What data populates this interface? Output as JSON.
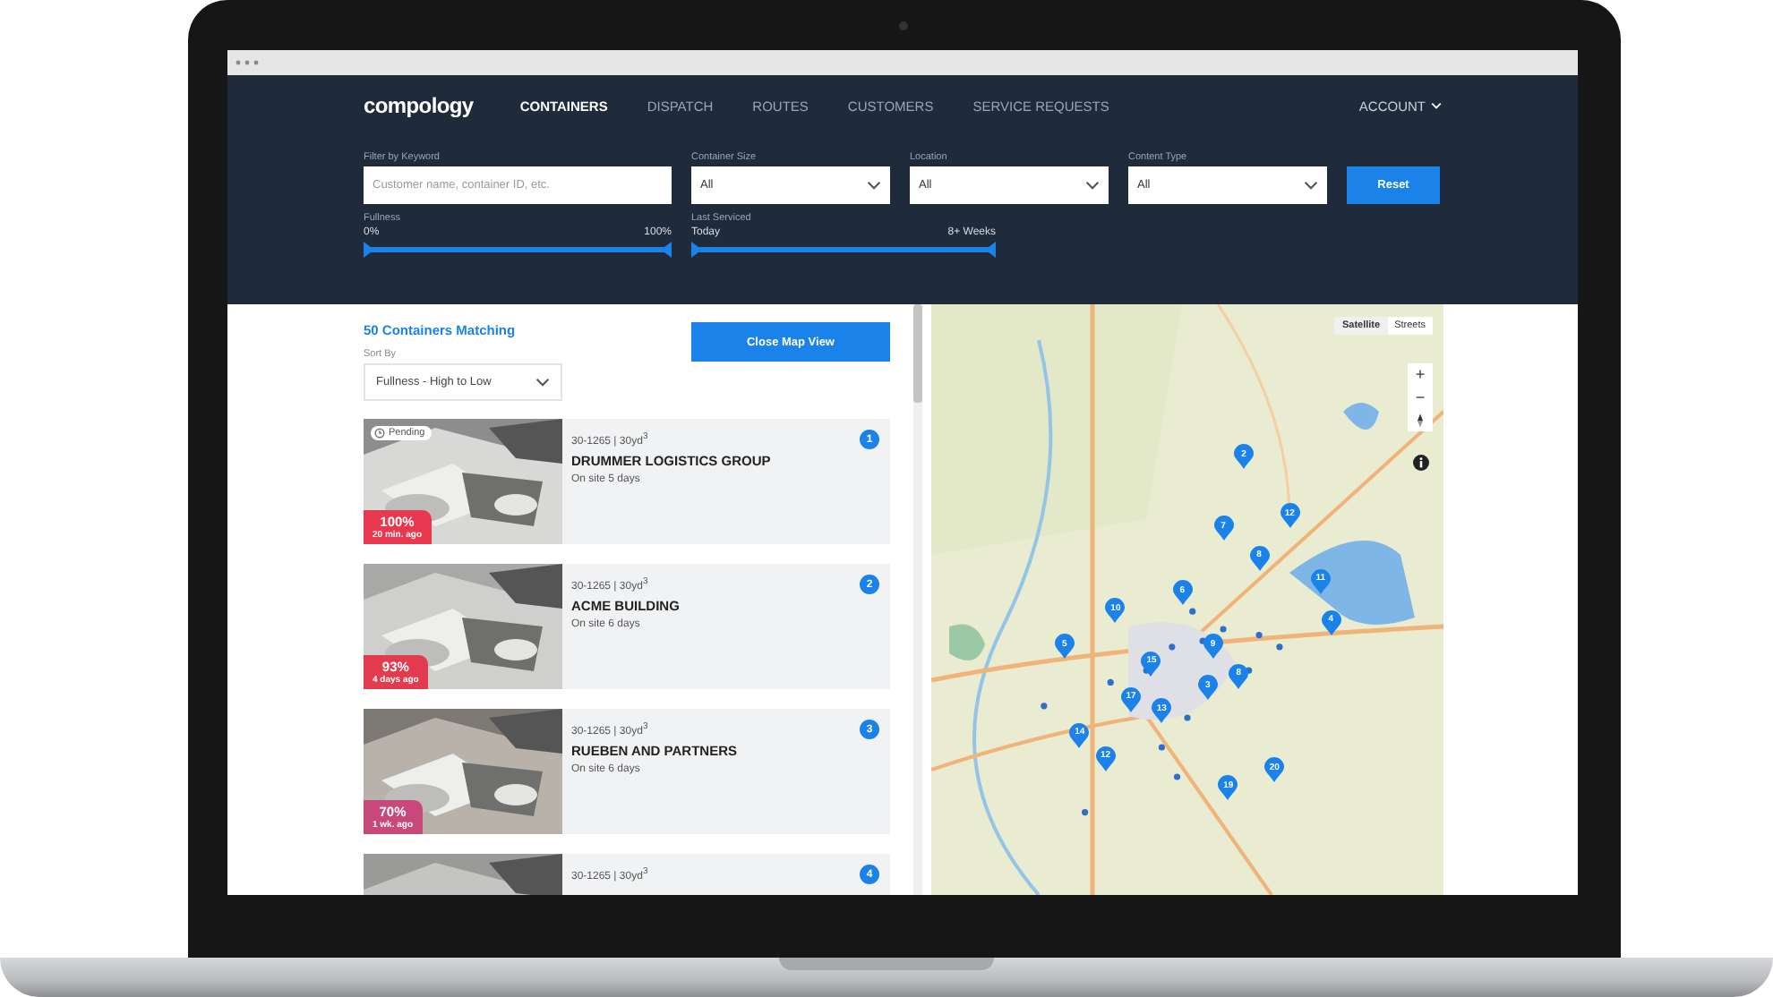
{
  "nav": {
    "logo": "compology",
    "items": [
      {
        "label": "CONTAINERS",
        "selected": true
      },
      {
        "label": "DISPATCH",
        "selected": false
      },
      {
        "label": "ROUTES",
        "selected": false
      },
      {
        "label": "CUSTOMERS",
        "selected": false
      },
      {
        "label": "SERVICE REQUESTS",
        "selected": false
      }
    ],
    "account": "ACCOUNT"
  },
  "filters": {
    "keyword": {
      "label": "Filter by Keyword",
      "placeholder": "Customer name, container ID, etc."
    },
    "selects": [
      {
        "label": "Container Size",
        "value": "All"
      },
      {
        "label": "Location",
        "value": "All"
      },
      {
        "label": "Content Type",
        "value": "All"
      }
    ],
    "reset": "Reset",
    "ranges": [
      {
        "label": "Fullness",
        "min": "0%",
        "max": "100%",
        "level": 1
      },
      {
        "label": "Last Serviced",
        "min": "Today",
        "max": "8+ Weeks",
        "level": 1
      }
    ]
  },
  "list": {
    "count": "50 Containers Matching",
    "sort_label": "Sort By",
    "sort_value": "Fullness - High to Low",
    "map_button": "Close Map View",
    "items": [
      {
        "pending": true,
        "pending_label": "Pending",
        "fullness": "100%",
        "age": "20 min. ago",
        "color": "#e8384f",
        "meta": "30-1265 | 30yd$^{3}$",
        "name": "DRUMMER LOGISTICS GROUP",
        "onsite": "On site 5 days",
        "number": "1"
      },
      {
        "pending": false,
        "fullness": "93%",
        "age": "4 days ago",
        "color": "#e23b4e",
        "meta": "30-1265 | 30yd$^{3}$",
        "name": "ACME BUILDING",
        "onsite": "On site 6 days",
        "number": "2"
      },
      {
        "pending": false,
        "fullness": "70%",
        "age": "1 wk. ago",
        "color": "#c8487a",
        "meta": "30-1265 | 30yd$^{3}$",
        "name": "RUEBEN AND PARTNERS",
        "onsite": "On site 6 days",
        "number": "3"
      },
      {
        "pending": false,
        "meta": "30-1265 | 30yd$^{3}$",
        "number": "4"
      }
    ]
  },
  "map": {
    "types": [
      {
        "label": "Satellite",
        "selected": true
      },
      {
        "label": "Streets",
        "selected": false
      }
    ],
    "zoom_in": "+",
    "zoom_out": "−",
    "pins": [
      "2",
      "7",
      "12",
      "8",
      "11",
      "4",
      "10",
      "6",
      "9",
      "5",
      "15",
      "17",
      "13",
      "3",
      "8",
      "14",
      "12",
      "19",
      "20"
    ]
  }
}
